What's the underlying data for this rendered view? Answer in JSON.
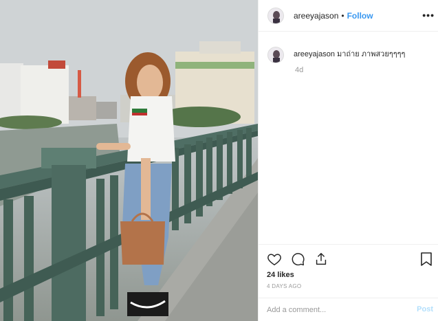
{
  "post": {
    "username": "areeyajason",
    "follow_label": "Follow",
    "separator": "•",
    "more_label": "•••",
    "caption_author": "areeyajason",
    "caption_text": "มาถ่าย ภาพสวยๆๆๆๆ",
    "caption_age": "4d",
    "likes": "24 likes",
    "date": "4 DAYS AGO",
    "comment_placeholder": "Add a comment...",
    "post_label": "Post"
  },
  "icons": {
    "like": "heart-icon",
    "comment": "comment-icon",
    "share": "share-icon",
    "save": "bookmark-icon",
    "more": "more-options-icon"
  },
  "colors": {
    "link_blue": "#3897f0",
    "post_disabled": "#b2dffc",
    "muted_text": "#999999",
    "border": "#efefef"
  }
}
